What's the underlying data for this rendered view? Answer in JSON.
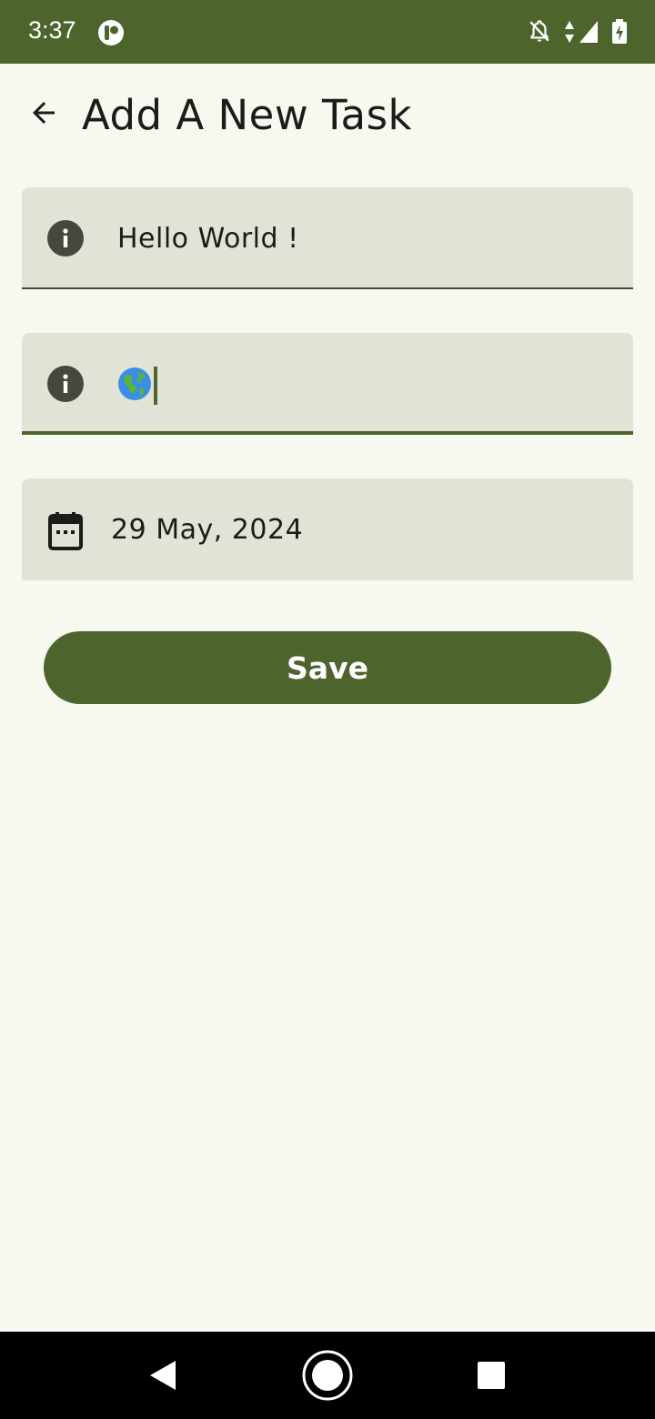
{
  "status_bar": {
    "time": "3:37",
    "icons": [
      "app-notification-icon",
      "notifications-off-icon",
      "data-arrows-icon",
      "signal-icon",
      "battery-charging-icon"
    ],
    "background_color": "#4d652d"
  },
  "app_bar": {
    "title": "Add A New Task",
    "back_icon": "arrow-back-icon"
  },
  "form": {
    "title_field": {
      "value": "Hello World !",
      "icon": "info-icon"
    },
    "description_field": {
      "value": "🌎",
      "icon": "info-icon",
      "focused": true
    },
    "date_field": {
      "value": "29 May, 2024",
      "icon": "calendar-icon"
    }
  },
  "save_button": {
    "label": "Save"
  },
  "colors": {
    "primary": "#4d652d",
    "background": "#f7f8f0",
    "field_background": "#e1e3d6",
    "text": "#1b1c17"
  },
  "nav_bar": {
    "icons": [
      "nav-back-icon",
      "nav-home-icon",
      "nav-recents-icon"
    ]
  }
}
